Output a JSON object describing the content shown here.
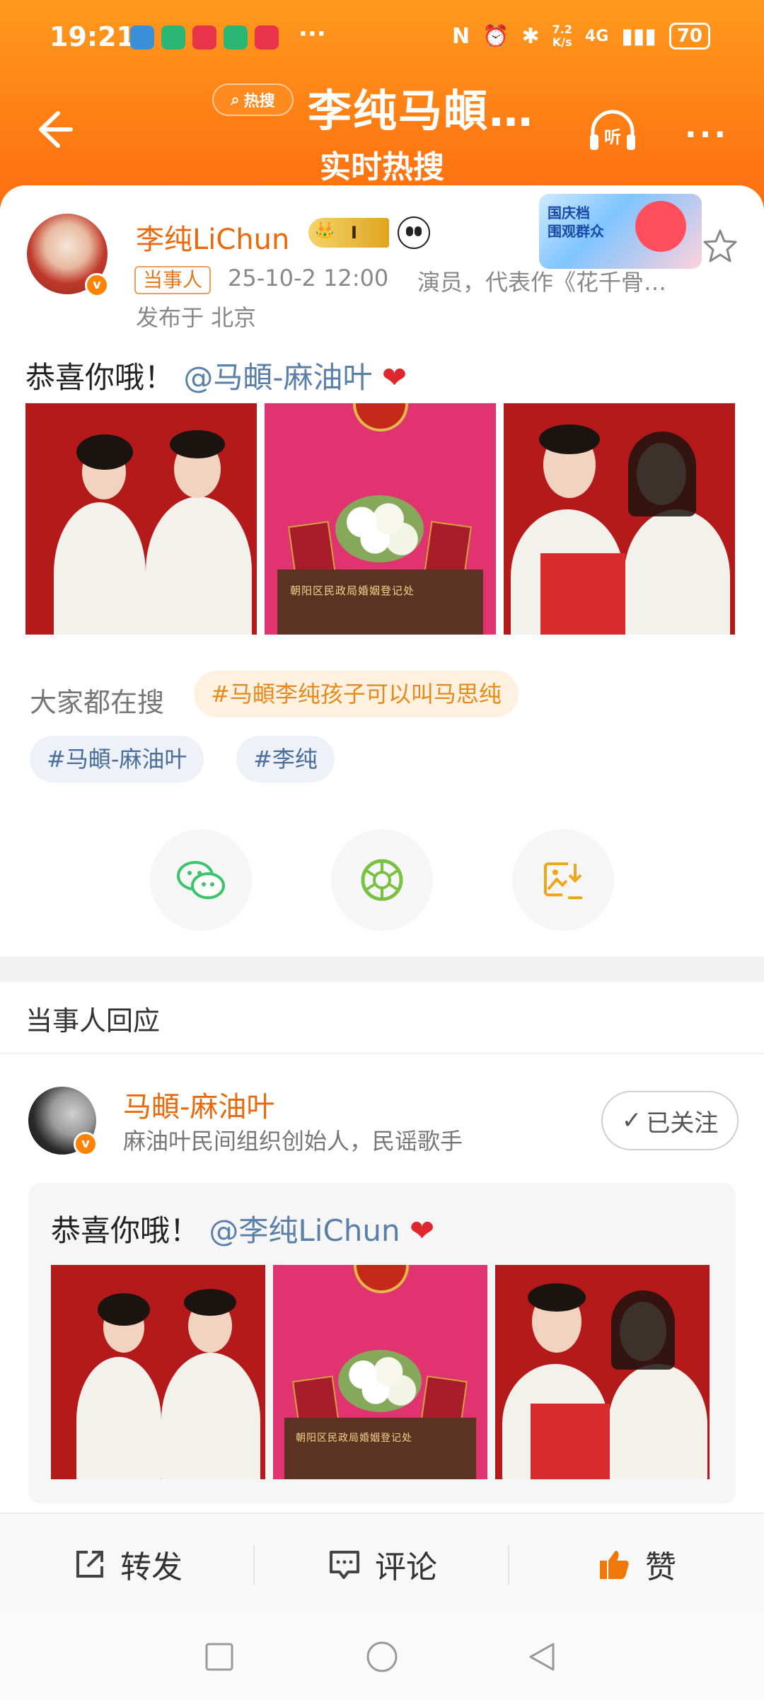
{
  "status_bar": {
    "time": "19:21",
    "more": "···",
    "net_speed": "7.2\nK/s",
    "network": "4G",
    "battery": "70"
  },
  "header": {
    "hot_badge": "热搜",
    "title": "李纯马頔…",
    "subtitle": "实时热搜",
    "listen_label": "听",
    "more": "···"
  },
  "post": {
    "author": "李纯LiChun",
    "crown_level": "I",
    "promo_text": "国庆档\n围观群众",
    "role_tag": "当事人",
    "time": "25-10-2 12:00",
    "description": "演员，代表作《花千骨…",
    "location": "发布于 北京",
    "text_prefix": "恭喜你哦！",
    "mention": "@马頔-麻油叶",
    "heart": "❤",
    "photo_caption": "朝阳区民政局婚姻登记处"
  },
  "search": {
    "label": "大家都在搜",
    "hot_tag": "#马頔李纯孩子可以叫马思纯",
    "tags": [
      "#马頔-麻油叶",
      "#李纯"
    ]
  },
  "share_icons": [
    "wechat-icon",
    "moments-icon",
    "save-image-icon"
  ],
  "response": {
    "section_title": "当事人回应",
    "name": "马頔-麻油叶",
    "description": "麻油叶民间组织创始人，民谣歌手",
    "follow_label": "已关注",
    "text_prefix": "恭喜你哦！",
    "mention": "@李纯LiChun",
    "heart": "❤",
    "photo_caption": "朝阳区民政局婚姻登记处"
  },
  "actions": {
    "repost": "转发",
    "comment": "评论",
    "like": "赞"
  },
  "colors": {
    "header_orange": "#ff7d14",
    "name_orange": "#e86a0c",
    "mention_blue": "#5a7fa8",
    "hot_chip": "#fff1e0"
  }
}
